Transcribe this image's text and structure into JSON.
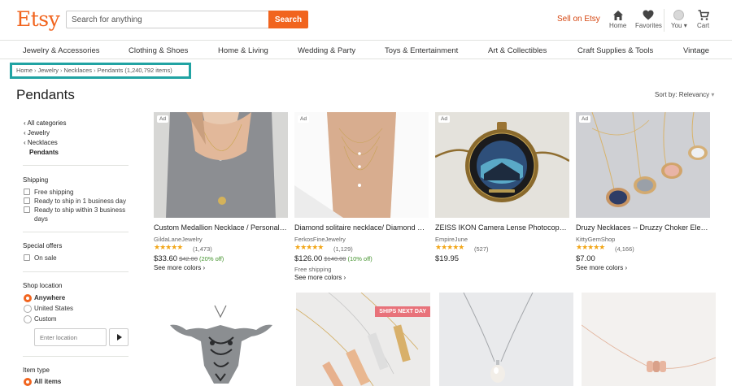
{
  "header": {
    "logo": "Etsy",
    "search_placeholder": "Search for anything",
    "search_button": "Search",
    "sell_link": "Sell on Etsy",
    "icons": [
      {
        "name": "home-icon",
        "label": "Home"
      },
      {
        "name": "heart-icon",
        "label": "Favorites"
      },
      {
        "name": "avatar",
        "label": "You ▾"
      },
      {
        "name": "cart-icon",
        "label": "Cart"
      }
    ]
  },
  "categories": [
    "Jewelry & Accessories",
    "Clothing & Shoes",
    "Home & Living",
    "Wedding & Party",
    "Toys & Entertainment",
    "Art & Collectibles",
    "Craft Supplies & Tools",
    "Vintage"
  ],
  "breadcrumb": {
    "items": [
      "Home",
      "Jewelry",
      "Necklaces"
    ],
    "current": "Pendants (1,240,792 items)"
  },
  "page_title": "Pendants",
  "sort_by": "Sort by: Relevancy",
  "sidebar": {
    "category_links": [
      "All categories",
      "Jewelry",
      "Necklaces"
    ],
    "current_category": "Pendants",
    "shipping": {
      "heading": "Shipping",
      "options": [
        "Free shipping",
        "Ready to ship in 1 business day",
        "Ready to ship within 3 business",
        "days"
      ]
    },
    "special_offers": {
      "heading": "Special offers",
      "options": [
        "On sale"
      ]
    },
    "shop_location": {
      "heading": "Shop location",
      "options": [
        "Anywhere",
        "United States",
        "Custom"
      ],
      "input_placeholder": "Enter location"
    },
    "item_type": {
      "heading": "Item type",
      "options": [
        "All items"
      ]
    }
  },
  "products": [
    {
      "ad": "Ad",
      "title": "Custom Medallion Necklace / Personalized Gift",
      "shop": "GildaLaneJewelry",
      "stars": "★★★★★",
      "reviews": "(1,473)",
      "price": "$33.60",
      "old_price": "$42.00",
      "discount": "(20% off)",
      "colors": "See more colors ›"
    },
    {
      "ad": "Ad",
      "title": "Diamond solitaire necklace/ Diamond necklace",
      "shop": "FerkosFineJewelry",
      "stars": "★★★★★",
      "reviews": "(1,129)",
      "price": "$126.00",
      "old_price": "$140.00",
      "discount": "(10% off)",
      "shipping": "Free shipping",
      "colors": "See more colors ›"
    },
    {
      "ad": "Ad",
      "title": "ZEISS IKON Camera Lense Photocopy Necklace",
      "shop": "EmpireJune",
      "stars": "★★★★★",
      "reviews": "(527)",
      "price": "$19.95"
    },
    {
      "ad": "Ad",
      "title": "Druzy Necklaces -- Druzzy Choker Elegant",
      "shop": "KittyGemShop",
      "stars": "★★★★★",
      "reviews": "(4,166)",
      "price": "$7.00",
      "colors": "See more colors ›"
    }
  ],
  "row2_badge": "SHIPS NEXT DAY"
}
